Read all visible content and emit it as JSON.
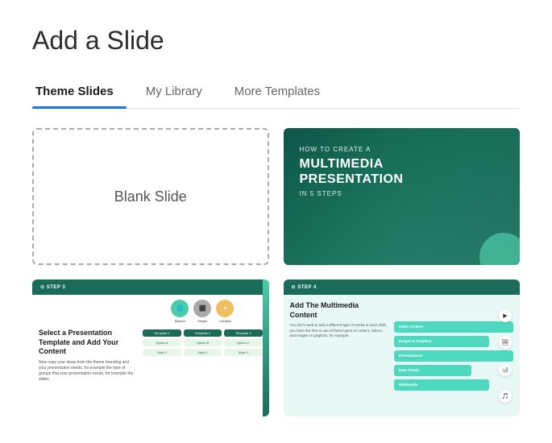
{
  "page": {
    "title": "Add a Slide"
  },
  "tabs": [
    {
      "id": "theme-slides",
      "label": "Theme Slides",
      "active": true
    },
    {
      "id": "my-library",
      "label": "My Library",
      "active": false
    },
    {
      "id": "more-templates",
      "label": "More Templates",
      "active": false
    }
  ],
  "slides": [
    {
      "id": "blank",
      "type": "blank",
      "label": "Blank Slide"
    },
    {
      "id": "multimedia",
      "type": "multimedia",
      "step_label": "HOW TO CREATE A",
      "title_line1": "MULTIMEDIA",
      "title_line2": "PRESENTATION",
      "title_line3": "IN 5 STEPS"
    },
    {
      "id": "step3",
      "type": "step3",
      "header": "⊙ STEP 3",
      "title": "Select a Presentation Template and Add Your Content",
      "icon1_label": "Modern",
      "icon2_label": "Simple",
      "icon3_label": "Creative"
    },
    {
      "id": "step4",
      "type": "step4",
      "header": "⊙ STEP 4",
      "title": "Add The Multimedia Content",
      "bars": [
        "",
        "",
        "",
        "",
        ""
      ]
    }
  ],
  "colors": {
    "accent_blue": "#1a73e8",
    "accent_green": "#1a6b5a",
    "accent_cyan": "#4dd9c0",
    "tab_active": "#1a1a1a"
  }
}
